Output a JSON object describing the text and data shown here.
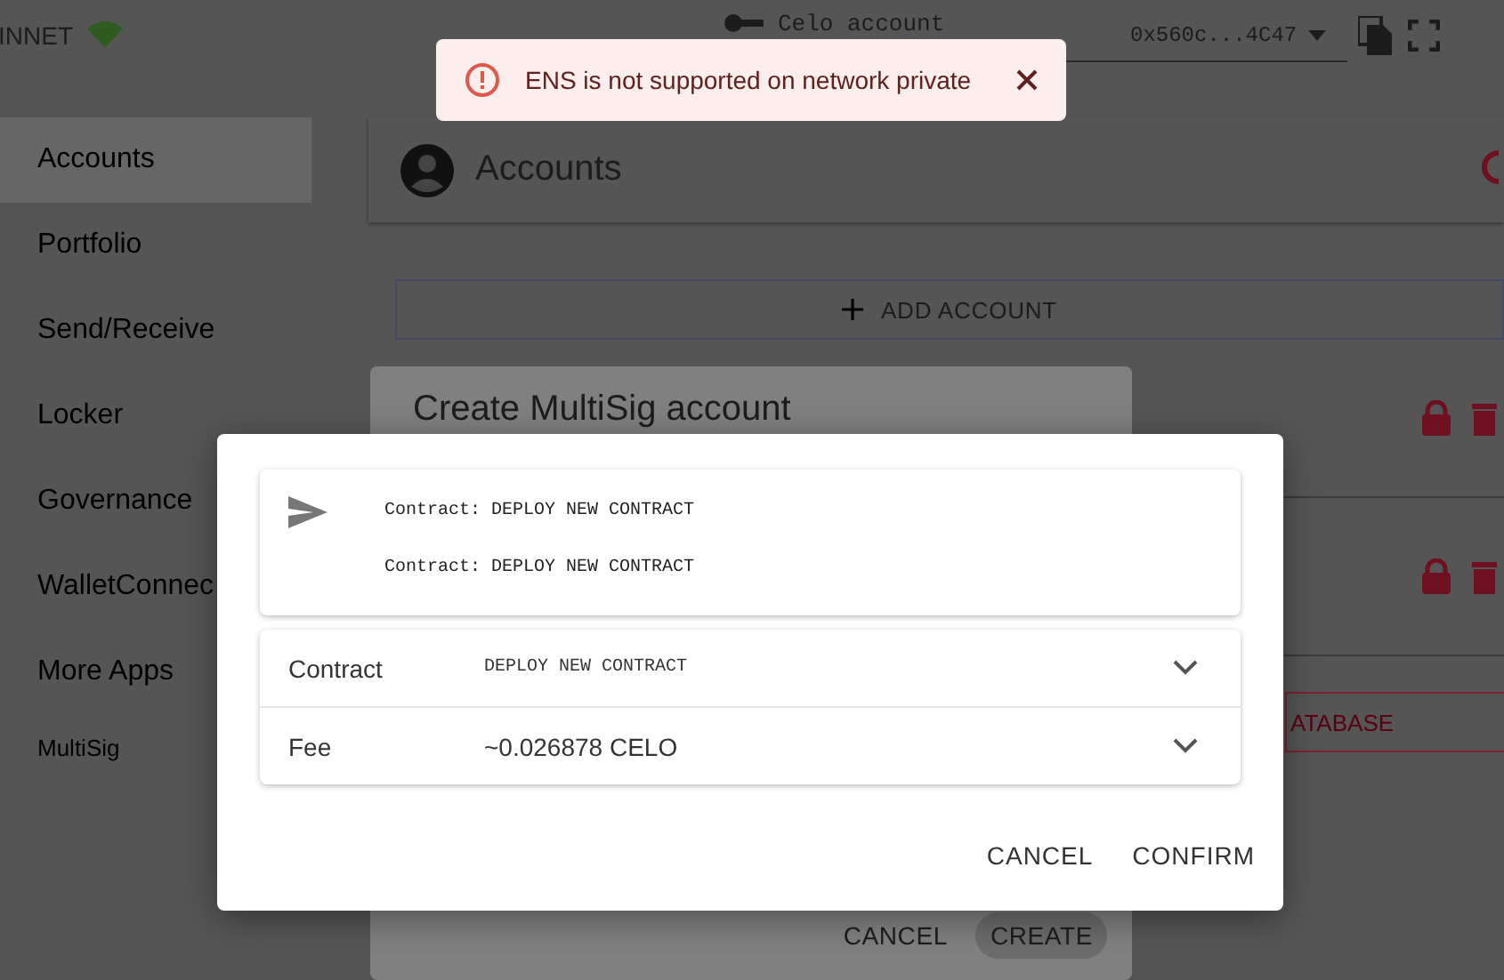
{
  "top_bar": {
    "network": "INNET",
    "account_label": "Celo account",
    "address": "0x560c...4C47"
  },
  "toast": {
    "message": "ENS is not supported on network private"
  },
  "sidebar": {
    "items": [
      {
        "label": "Accounts",
        "selected": true
      },
      {
        "label": "Portfolio",
        "selected": false
      },
      {
        "label": "Send/Receive",
        "selected": false
      },
      {
        "label": "Locker",
        "selected": false
      },
      {
        "label": "Governance",
        "selected": false
      },
      {
        "label": "WalletConnec",
        "selected": false
      },
      {
        "label": "More Apps",
        "selected": false
      },
      {
        "label": "MultiSig",
        "selected": false
      }
    ]
  },
  "main": {
    "title": "Accounts",
    "add_button": "ADD ACCOUNT",
    "account_rows": [
      {
        "kind": "locked"
      },
      {
        "kind": "locked"
      }
    ],
    "database_button": "ATABASE"
  },
  "create_dialog": {
    "title": "Create MultiSig account",
    "buttons": [
      "CANCEL",
      "CREATE"
    ]
  },
  "confirm_dialog": {
    "summary": [
      "Contract: DEPLOY NEW CONTRACT",
      "Contract: DEPLOY NEW CONTRACT"
    ],
    "details": [
      {
        "label": "Contract",
        "value": "DEPLOY NEW CONTRACT",
        "kind": "mono",
        "expanded": false
      },
      {
        "label": "Fee",
        "value": "~0.026878 CELO",
        "kind": "plain",
        "expanded": false
      }
    ],
    "buttons": [
      "CANCEL",
      "CONFIRM"
    ]
  }
}
